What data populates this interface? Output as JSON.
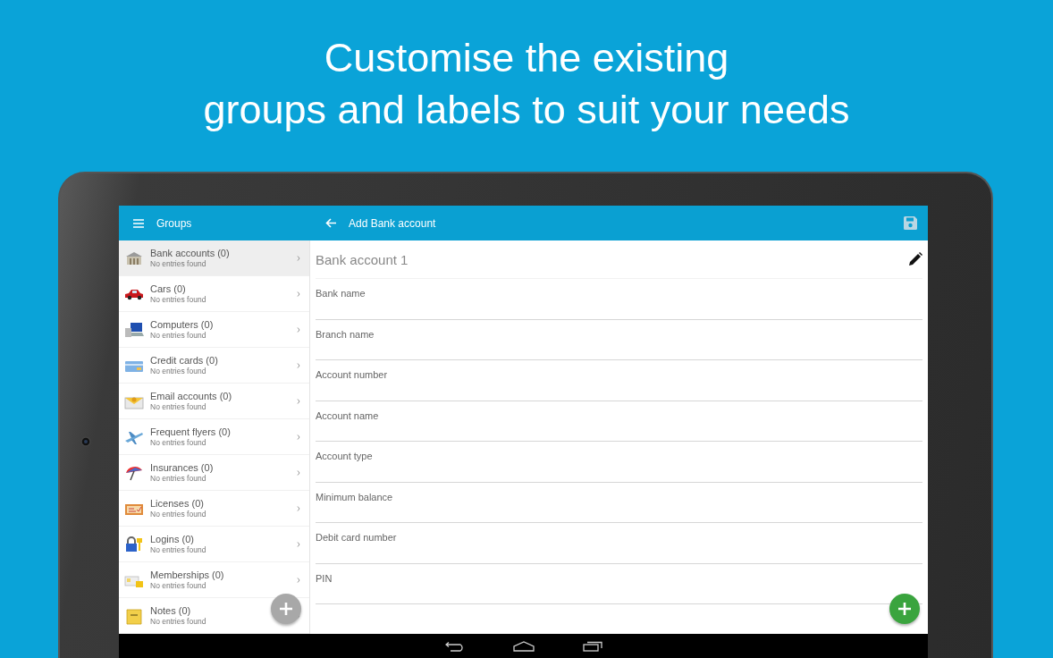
{
  "headline": "Customise the existing\ngroups and labels to suit your needs",
  "sidebar": {
    "title": "Groups",
    "items": [
      {
        "title": "Bank accounts (0)",
        "subtitle": "No entries found",
        "selected": true
      },
      {
        "title": "Cars (0)",
        "subtitle": "No entries found",
        "selected": false
      },
      {
        "title": "Computers (0)",
        "subtitle": "No entries found",
        "selected": false
      },
      {
        "title": "Credit cards (0)",
        "subtitle": "No entries found",
        "selected": false
      },
      {
        "title": "Email accounts (0)",
        "subtitle": "No entries found",
        "selected": false
      },
      {
        "title": "Frequent flyers (0)",
        "subtitle": "No entries found",
        "selected": false
      },
      {
        "title": "Insurances (0)",
        "subtitle": "No entries found",
        "selected": false
      },
      {
        "title": "Licenses (0)",
        "subtitle": "No entries found",
        "selected": false
      },
      {
        "title": "Logins (0)",
        "subtitle": "No entries found",
        "selected": false
      },
      {
        "title": "Memberships (0)",
        "subtitle": "No entries found",
        "selected": false
      },
      {
        "title": "Notes (0)",
        "subtitle": "No entries found",
        "selected": false
      }
    ]
  },
  "editor": {
    "title": "Add Bank account",
    "save_disabled": true,
    "name": "Bank account 1",
    "fields": [
      {
        "placeholder": "Bank name"
      },
      {
        "placeholder": "Branch name"
      },
      {
        "placeholder": "Account number"
      },
      {
        "placeholder": "Account name"
      },
      {
        "placeholder": "Account type"
      },
      {
        "placeholder": "Minimum balance"
      },
      {
        "placeholder": "Debit card number"
      },
      {
        "placeholder": "PIN"
      }
    ]
  }
}
